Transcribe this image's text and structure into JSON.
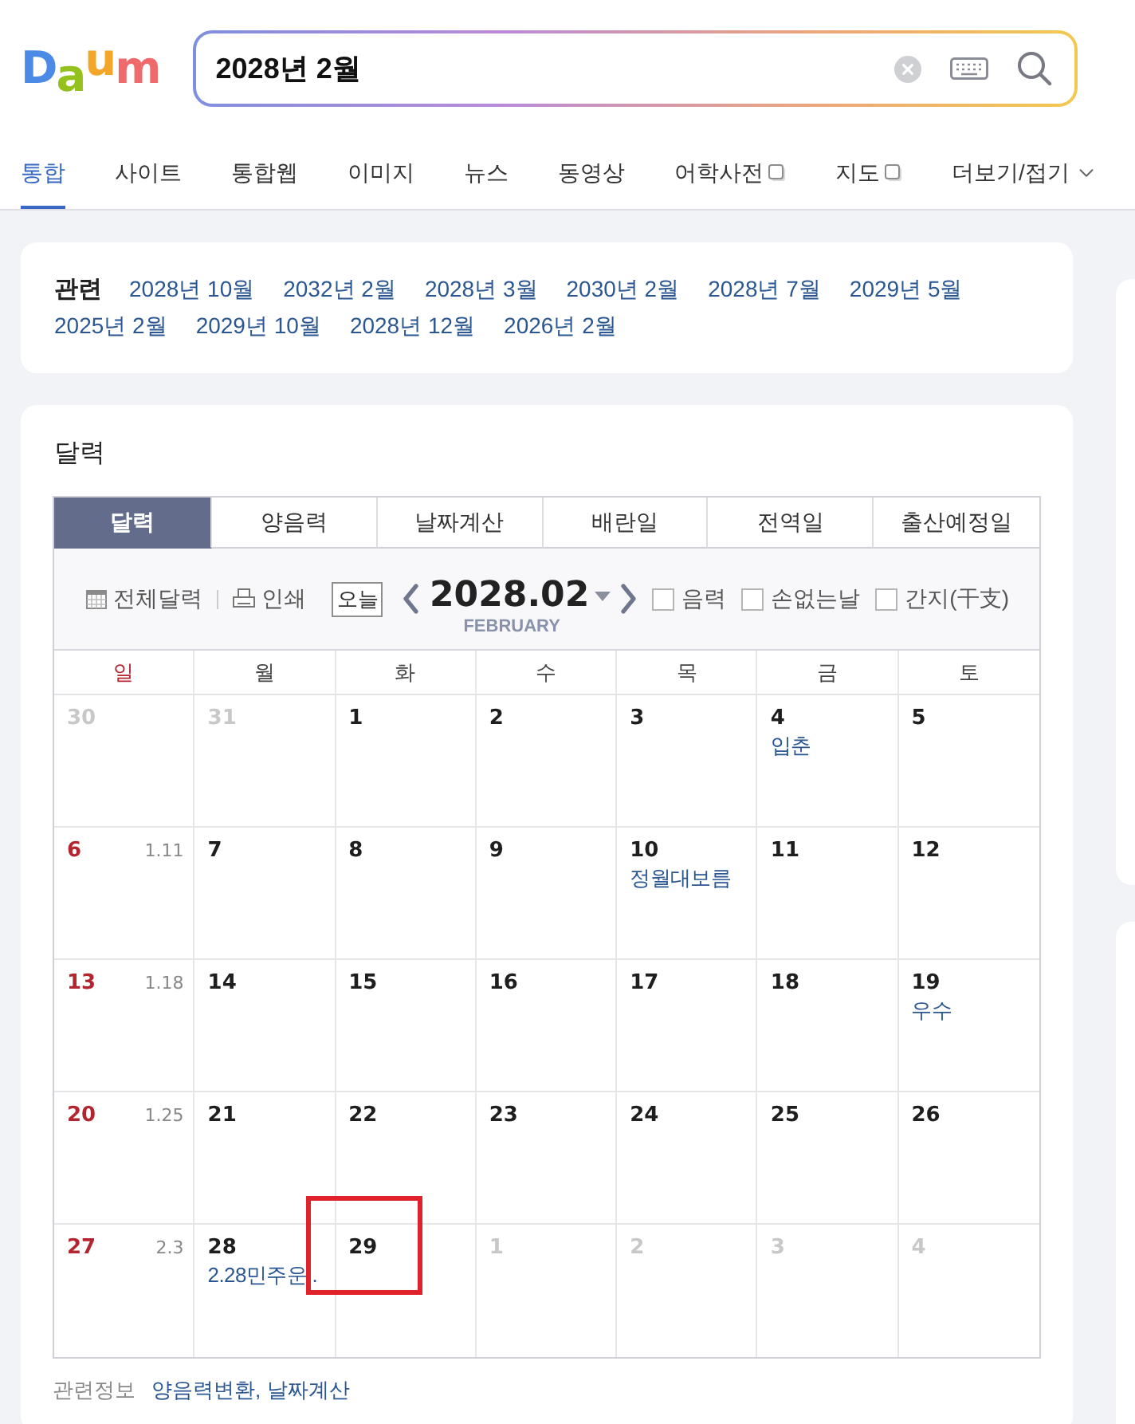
{
  "logo": {
    "text": "Daum"
  },
  "search": {
    "value": "2028년 2월"
  },
  "nav_tabs": [
    {
      "label": "통합",
      "selected": true,
      "kind": "plain"
    },
    {
      "label": "사이트",
      "selected": false,
      "kind": "plain"
    },
    {
      "label": "통합웹",
      "selected": false,
      "kind": "plain"
    },
    {
      "label": "이미지",
      "selected": false,
      "kind": "plain"
    },
    {
      "label": "뉴스",
      "selected": false,
      "kind": "plain"
    },
    {
      "label": "동영상",
      "selected": false,
      "kind": "plain"
    },
    {
      "label": "어학사전",
      "selected": false,
      "kind": "layer"
    },
    {
      "label": "지도",
      "selected": false,
      "kind": "layer"
    },
    {
      "label": "더보기/접기",
      "selected": false,
      "kind": "more"
    }
  ],
  "related": {
    "label": "관련",
    "links": [
      "2028년 10월",
      "2032년 2월",
      "2028년 3월",
      "2030년 2월",
      "2028년 7월",
      "2029년 5월",
      "2025년 2월",
      "2029년 10월",
      "2028년 12월",
      "2026년 2월"
    ]
  },
  "calendar": {
    "title": "달력",
    "tabs": [
      {
        "label": "달력",
        "selected": true
      },
      {
        "label": "양음력",
        "selected": false
      },
      {
        "label": "날짜계산",
        "selected": false
      },
      {
        "label": "배란일",
        "selected": false
      },
      {
        "label": "전역일",
        "selected": false
      },
      {
        "label": "출산예정일",
        "selected": false
      }
    ],
    "toolbar": {
      "full_calendar": "전체달력",
      "print": "인쇄",
      "today": "오늘",
      "month": "2028.02",
      "month_name": "FEBRUARY",
      "options": [
        {
          "label": "음력",
          "checked": false
        },
        {
          "label": "손없는날",
          "checked": false
        },
        {
          "label": "간지(干支)",
          "checked": false
        }
      ]
    },
    "weekdays": [
      {
        "label": "일",
        "kind": "sunday"
      },
      {
        "label": "월",
        "kind": "weekday"
      },
      {
        "label": "화",
        "kind": "weekday"
      },
      {
        "label": "수",
        "kind": "weekday"
      },
      {
        "label": "목",
        "kind": "weekday"
      },
      {
        "label": "금",
        "kind": "weekday"
      },
      {
        "label": "토",
        "kind": "weekday"
      }
    ],
    "weeks": [
      [
        {
          "day": "30",
          "kind": "outside",
          "marked": false
        },
        {
          "day": "31",
          "kind": "outside",
          "marked": false
        },
        {
          "day": "1",
          "kind": "day",
          "marked": false
        },
        {
          "day": "2",
          "kind": "day",
          "marked": false
        },
        {
          "day": "3",
          "kind": "day",
          "marked": false
        },
        {
          "day": "4",
          "kind": "day",
          "event": "입춘",
          "marked": false
        },
        {
          "day": "5",
          "kind": "day",
          "marked": false
        }
      ],
      [
        {
          "day": "6",
          "kind": "sunday",
          "lunar": "1.11",
          "marked": false
        },
        {
          "day": "7",
          "kind": "day",
          "marked": false
        },
        {
          "day": "8",
          "kind": "day",
          "marked": false
        },
        {
          "day": "9",
          "kind": "day",
          "marked": false
        },
        {
          "day": "10",
          "kind": "day",
          "event": "정월대보름",
          "marked": false
        },
        {
          "day": "11",
          "kind": "day",
          "marked": false
        },
        {
          "day": "12",
          "kind": "day",
          "marked": false
        }
      ],
      [
        {
          "day": "13",
          "kind": "sunday",
          "lunar": "1.18",
          "marked": false
        },
        {
          "day": "14",
          "kind": "day",
          "marked": false
        },
        {
          "day": "15",
          "kind": "day",
          "marked": false
        },
        {
          "day": "16",
          "kind": "day",
          "marked": false
        },
        {
          "day": "17",
          "kind": "day",
          "marked": false
        },
        {
          "day": "18",
          "kind": "day",
          "marked": false
        },
        {
          "day": "19",
          "kind": "day",
          "event": "우수",
          "marked": false
        }
      ],
      [
        {
          "day": "20",
          "kind": "sunday",
          "lunar": "1.25",
          "marked": false
        },
        {
          "day": "21",
          "kind": "day",
          "marked": false
        },
        {
          "day": "22",
          "kind": "day",
          "marked": false
        },
        {
          "day": "23",
          "kind": "day",
          "marked": false
        },
        {
          "day": "24",
          "kind": "day",
          "marked": false
        },
        {
          "day": "25",
          "kind": "day",
          "marked": false
        },
        {
          "day": "26",
          "kind": "day",
          "marked": false
        }
      ],
      [
        {
          "day": "27",
          "kind": "sunday",
          "lunar": "2.3",
          "marked": false
        },
        {
          "day": "28",
          "kind": "day",
          "event": "2.28민주운..",
          "marked": false
        },
        {
          "day": "29",
          "kind": "day",
          "marked": true
        },
        {
          "day": "1",
          "kind": "outside",
          "marked": false
        },
        {
          "day": "2",
          "kind": "outside",
          "marked": false
        },
        {
          "day": "3",
          "kind": "outside",
          "marked": false
        },
        {
          "day": "4",
          "kind": "outside",
          "marked": false
        }
      ]
    ]
  },
  "related_info": {
    "label": "관련정보",
    "links": [
      "양음력변환",
      "날짜계산"
    ],
    "separator": ","
  }
}
